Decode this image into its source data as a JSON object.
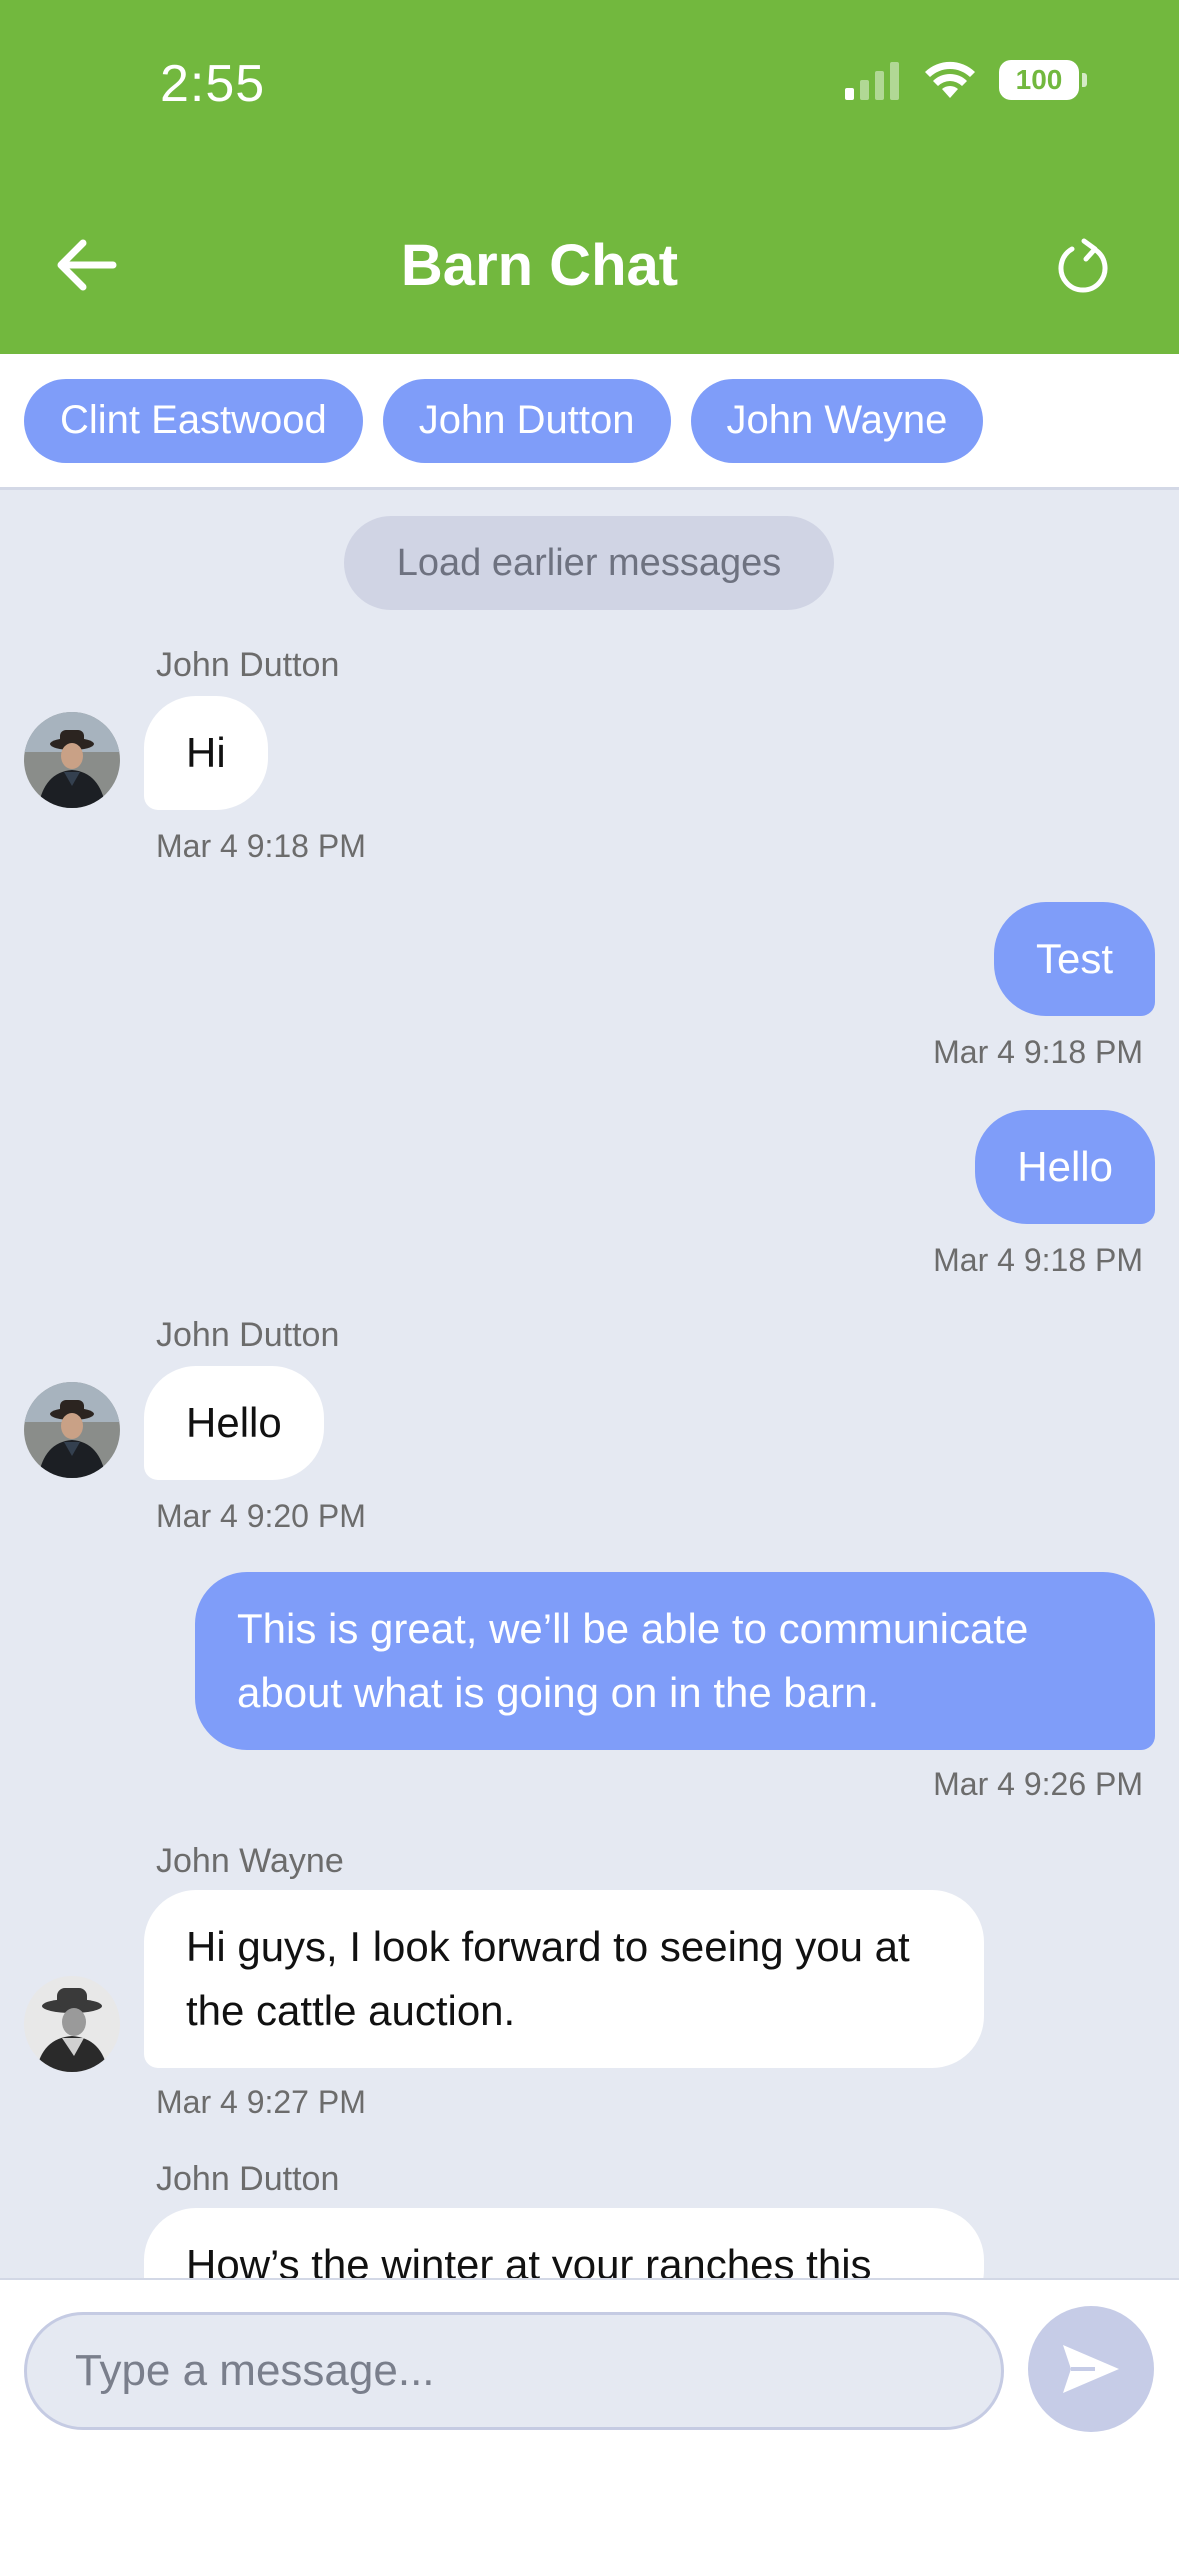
{
  "status_bar": {
    "time": "2:55",
    "battery": "100"
  },
  "header": {
    "title": "Barn Chat"
  },
  "participants": [
    "Clint Eastwood",
    "John Dutton",
    "John Wayne"
  ],
  "load_earlier_label": "Load earlier messages",
  "messages": [
    {
      "direction": "incoming",
      "sender": "John Dutton",
      "text": "Hi",
      "time": "Mar 4 9:18 PM"
    },
    {
      "direction": "outgoing",
      "text": "Test",
      "time": "Mar 4 9:18 PM"
    },
    {
      "direction": "outgoing",
      "text": "Hello",
      "time": "Mar 4 9:18 PM"
    },
    {
      "direction": "incoming",
      "sender": "John Dutton",
      "text": "Hello",
      "time": "Mar 4 9:20 PM"
    },
    {
      "direction": "outgoing",
      "text": "This is great, we’ll be able to communicate about what is going on in the barn.",
      "time": "Mar 4 9:26 PM"
    },
    {
      "direction": "incoming",
      "sender": "John Wayne",
      "text": "Hi guys, I look forward to seeing you at the cattle auction.",
      "time": "Mar 4 9:27 PM"
    },
    {
      "direction": "incoming",
      "sender": "John Dutton",
      "text": "How’s the winter at your ranches this"
    }
  ],
  "composer": {
    "placeholder": "Type a message..."
  },
  "colors": {
    "header_bg": "#72b83e",
    "accent": "#7f9df9",
    "chat_bg": "#e5e9f2"
  }
}
